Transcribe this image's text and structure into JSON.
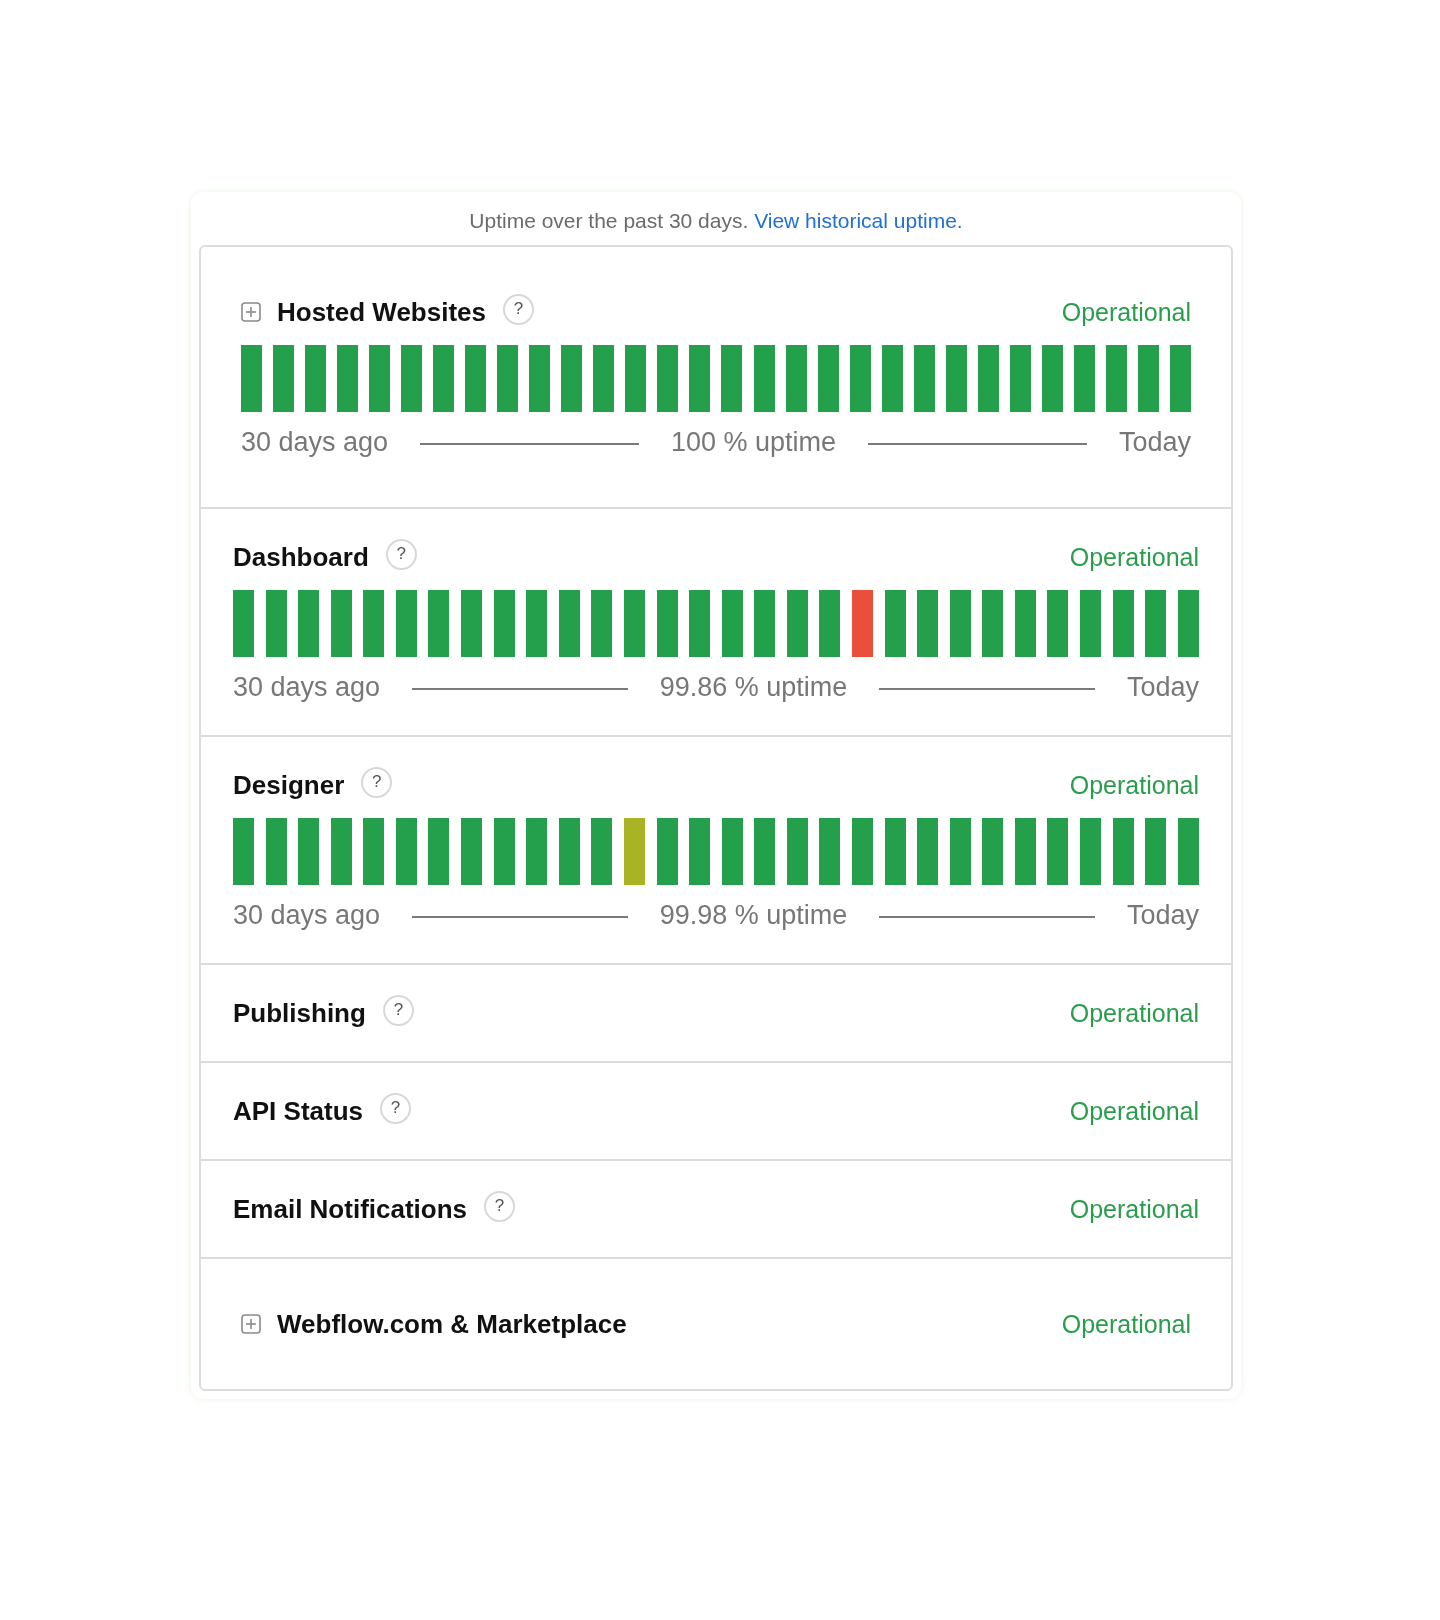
{
  "uptime_note": {
    "text": "Uptime over the past 30 days.",
    "link": "View historical uptime."
  },
  "components": [
    {
      "kind": "group",
      "expanded": false,
      "name": "Hosted Websites",
      "help": "?",
      "status": "Operational",
      "days": [
        {
          "color": "#24a04d"
        },
        {
          "color": "#24a04d"
        },
        {
          "color": "#24a04d"
        },
        {
          "color": "#24a04d"
        },
        {
          "color": "#24a04d"
        },
        {
          "color": "#24a04d"
        },
        {
          "color": "#24a04d"
        },
        {
          "color": "#24a04d"
        },
        {
          "color": "#24a04d"
        },
        {
          "color": "#24a04d"
        },
        {
          "color": "#24a04d"
        },
        {
          "color": "#24a04d"
        },
        {
          "color": "#24a04d"
        },
        {
          "color": "#24a04d"
        },
        {
          "color": "#24a04d"
        },
        {
          "color": "#24a04d"
        },
        {
          "color": "#24a04d"
        },
        {
          "color": "#24a04d"
        },
        {
          "color": "#24a04d"
        },
        {
          "color": "#24a04d"
        },
        {
          "color": "#24a04d"
        },
        {
          "color": "#24a04d"
        },
        {
          "color": "#24a04d"
        },
        {
          "color": "#24a04d"
        },
        {
          "color": "#24a04d"
        },
        {
          "color": "#24a04d"
        },
        {
          "color": "#24a04d"
        },
        {
          "color": "#24a04d"
        },
        {
          "color": "#24a04d"
        },
        {
          "color": "#24a04d"
        }
      ],
      "start_label": "30 days ago",
      "uptime": "100 % uptime",
      "end_label": "Today"
    },
    {
      "kind": "component",
      "name": "Dashboard",
      "help": "?",
      "status": "Operational",
      "days": [
        {
          "color": "#24a04d"
        },
        {
          "color": "#24a04d"
        },
        {
          "color": "#24a04d"
        },
        {
          "color": "#24a04d"
        },
        {
          "color": "#24a04d"
        },
        {
          "color": "#24a04d"
        },
        {
          "color": "#24a04d"
        },
        {
          "color": "#24a04d"
        },
        {
          "color": "#24a04d"
        },
        {
          "color": "#24a04d"
        },
        {
          "color": "#24a04d"
        },
        {
          "color": "#24a04d"
        },
        {
          "color": "#24a04d"
        },
        {
          "color": "#24a04d"
        },
        {
          "color": "#24a04d"
        },
        {
          "color": "#24a04d"
        },
        {
          "color": "#24a04d"
        },
        {
          "color": "#24a04d"
        },
        {
          "color": "#24a04d"
        },
        {
          "color": "#e9503c"
        },
        {
          "color": "#24a04d"
        },
        {
          "color": "#24a04d"
        },
        {
          "color": "#24a04d"
        },
        {
          "color": "#24a04d"
        },
        {
          "color": "#24a04d"
        },
        {
          "color": "#24a04d"
        },
        {
          "color": "#24a04d"
        },
        {
          "color": "#24a04d"
        },
        {
          "color": "#24a04d"
        },
        {
          "color": "#24a04d"
        }
      ],
      "start_label": "30 days ago",
      "uptime": "99.86 % uptime",
      "end_label": "Today"
    },
    {
      "kind": "component",
      "name": "Designer",
      "help": "?",
      "status": "Operational",
      "days": [
        {
          "color": "#24a04d"
        },
        {
          "color": "#24a04d"
        },
        {
          "color": "#24a04d"
        },
        {
          "color": "#24a04d"
        },
        {
          "color": "#24a04d"
        },
        {
          "color": "#24a04d"
        },
        {
          "color": "#24a04d"
        },
        {
          "color": "#24a04d"
        },
        {
          "color": "#24a04d"
        },
        {
          "color": "#24a04d"
        },
        {
          "color": "#24a04d"
        },
        {
          "color": "#24a04d"
        },
        {
          "color": "#a8b424"
        },
        {
          "color": "#24a04d"
        },
        {
          "color": "#24a04d"
        },
        {
          "color": "#24a04d"
        },
        {
          "color": "#24a04d"
        },
        {
          "color": "#24a04d"
        },
        {
          "color": "#24a04d"
        },
        {
          "color": "#24a04d"
        },
        {
          "color": "#24a04d"
        },
        {
          "color": "#24a04d"
        },
        {
          "color": "#24a04d"
        },
        {
          "color": "#24a04d"
        },
        {
          "color": "#24a04d"
        },
        {
          "color": "#24a04d"
        },
        {
          "color": "#24a04d"
        },
        {
          "color": "#24a04d"
        },
        {
          "color": "#24a04d"
        },
        {
          "color": "#24a04d"
        }
      ],
      "start_label": "30 days ago",
      "uptime": "99.98 % uptime",
      "end_label": "Today"
    },
    {
      "kind": "component",
      "name": "Publishing",
      "help": "?",
      "status": "Operational"
    },
    {
      "kind": "component",
      "name": "API Status",
      "help": "?",
      "status": "Operational"
    },
    {
      "kind": "component",
      "name": "Email Notifications",
      "help": "?",
      "status": "Operational"
    },
    {
      "kind": "group",
      "expanded": false,
      "name": "Webflow.com & Marketplace",
      "status": "Operational"
    }
  ]
}
